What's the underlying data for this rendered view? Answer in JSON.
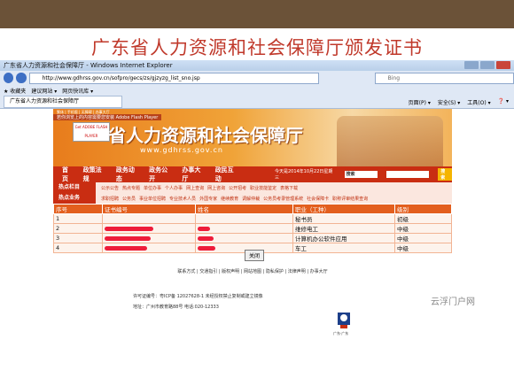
{
  "slide": {
    "title": "广东省人力资源和社会保障厅颁发证书"
  },
  "window": {
    "title": "广东省人力资源和社会保障厅 - Windows Internet Explorer",
    "address": "http://www.gdhrss.gov.cn/sofpro/gecs/zs/gjzyzg_list_sno.jsp",
    "search_placeholder": "Bing",
    "favorites_label": "收藏夹",
    "fav_item1": "建议网站 ▾",
    "fav_item2": "网页快讯库 ▾",
    "tab_label": "广东省人力资源和社会保障厅",
    "tools": [
      "页面(P) ▾",
      "安全(S) ▾",
      "工具(O) ▾",
      "❓ ▾"
    ]
  },
  "site": {
    "top_links": "繁体 | 手机版 | 无障碍 | 办事大厅",
    "flash_warning": "若你浏览上的内容需要您安装 Adobe Flash Player",
    "flash_badge": "Get ADOBE FLASH PLAYER",
    "name": "省人力资源和社会保障厅",
    "url": "www.gdhrss.gov.cn",
    "nav": [
      "首页",
      "政策法规",
      "政务动态",
      "政务公开",
      "办事大厅",
      "政民互动"
    ],
    "date": "今天是2014年10月22日星期三",
    "search_select": "搜索",
    "search_button": "搜索",
    "hot_label": "热点栏目",
    "hot_items": [
      "公示公告",
      "热点专题",
      "单位办事",
      "个人办事",
      "网上查询",
      "网上咨询",
      "公开招考",
      "职业技能鉴定",
      "表格下载"
    ],
    "biz_label": "热点业务",
    "biz_items": [
      "求职招聘",
      "公务员",
      "事业单位招聘",
      "专业技术人员",
      "外国专家",
      "继续教育",
      "调解仲裁",
      "公务员考录管理系统",
      "社会保障卡",
      "职称评审结果查询"
    ]
  },
  "table": {
    "headers": [
      "序号",
      "证书编号",
      "姓名",
      "职业（工种）",
      "级别"
    ],
    "rows": [
      {
        "no": "1",
        "job": "秘书员",
        "level": "初级"
      },
      {
        "no": "2",
        "job": "维修电工",
        "level": "中级"
      },
      {
        "no": "3",
        "job": "计算机办公软件应用",
        "level": "中级"
      },
      {
        "no": "4",
        "job": "车工",
        "level": "中级"
      }
    ]
  },
  "close_button": "关闭",
  "footer": {
    "links": "联系方式 | 交通指引 | 版权声明 | 网站地图 | 隐私保护 | 法律声明 | 办事大厅",
    "icp": "许可证编号：粤ICP备 12027628-1 未经授权禁止复制或建立镜像",
    "address": "地址：广州市教育路88号  电话:020-12333",
    "logo_label": "广东·广东"
  },
  "watermark": "云浮门户网"
}
